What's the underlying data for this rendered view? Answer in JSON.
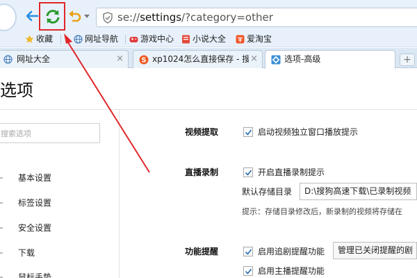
{
  "toolbar": {
    "address": {
      "prefix": "se://",
      "host": "settings",
      "suffix": "/?category=other"
    },
    "icons": {
      "back": "back-arrow-icon",
      "refresh": "refresh-icon",
      "undo": "undo-icon",
      "security": "shield-icon"
    },
    "colors": {
      "accent": "#2a8de0",
      "refresh": "#2c9a2e",
      "undo": "#e8a21a",
      "annotation": "#e0262a"
    }
  },
  "bookmarks": [
    {
      "label": "收藏",
      "icon": "star-icon"
    },
    {
      "label": "网址导航",
      "icon": "globe-icon"
    },
    {
      "label": "游戏中心",
      "icon": "game-icon"
    },
    {
      "label": "小说大全",
      "icon": "book-icon"
    },
    {
      "label": "爱淘宝",
      "icon": "tao-icon"
    }
  ],
  "tabs": [
    {
      "label": "网址大全",
      "icon": "globe-icon",
      "close": "×"
    },
    {
      "label": "xp1024怎么直接保存 - 搜",
      "icon": "sogou-icon",
      "close": "×"
    },
    {
      "label": "选项-高级",
      "icon": "gear-icon",
      "close": "",
      "active": true
    }
  ],
  "new_tab": "+",
  "page": {
    "title": "选项",
    "search_placeholder": "搜索选项"
  },
  "sidebar": {
    "items": [
      {
        "label": "基本设置"
      },
      {
        "label": "标签设置"
      },
      {
        "label": "安全设置"
      },
      {
        "label": "下载"
      },
      {
        "label": "鼠标手势"
      }
    ]
  },
  "settings": {
    "video": {
      "title": "视频提取",
      "option": "启动视频独立窗口播放提示",
      "checked": true
    },
    "live": {
      "title": "直播录制",
      "option": "开启直播录制提示",
      "checked": true,
      "dir_label": "默认存储目录",
      "dir_value": "D:\\搜狗高速下载\\已录制视频",
      "hint": "提示：存储目录修改后，新录制的视频将存储在"
    },
    "reminder": {
      "title": "功能提醒",
      "option1": "启用追剧提醒功能",
      "option1_checked": true,
      "manage_button": "管理已关闭提醒的剧",
      "option2": "启用主播提醒功能",
      "option2_checked": true
    }
  }
}
